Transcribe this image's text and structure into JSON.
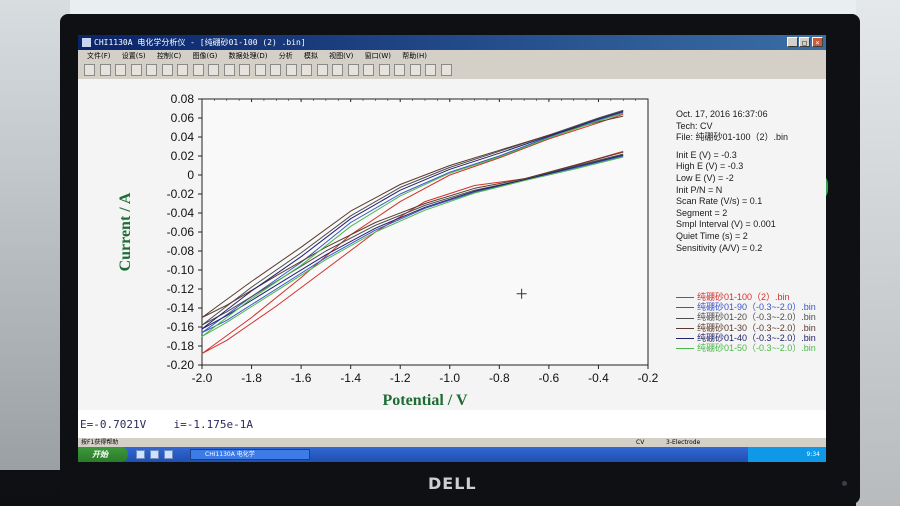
{
  "window": {
    "title": "CHI1130A 电化学分析仪 - [纯硼砂01-100 (2) .bin]",
    "controls": [
      "_",
      "□",
      "×"
    ]
  },
  "menu": [
    "文件(F)",
    "设置(S)",
    "控制(C)",
    "图像(G)",
    "数据处理(D)",
    "分析",
    "模拟",
    "视图(V)",
    "窗口(W)",
    "帮助(H)"
  ],
  "toolbar_icons": [
    "new-icon",
    "open-icon",
    "save-icon",
    "print-icon",
    "technique-icon",
    "parameters-icon",
    "run-icon",
    "pause-icon",
    "stop-icon",
    "reverse-icon",
    "ir-comp-icon",
    "filter-icon",
    "zoom-icon",
    "overlay-icon",
    "add-icon",
    "graph-icon",
    "color-icon",
    "smooth-icon",
    "derivative-icon",
    "integrate-icon",
    "baseline-icon",
    "peak-icon",
    "data-list-icon",
    "help-icon"
  ],
  "info": {
    "date": "Oct. 17, 2016   16:37:06",
    "tech": "Tech: CV",
    "file": "File: 纯硼砂01-100（2）.bin",
    "params": [
      "Init E (V) = -0.3",
      "High E (V) = -0.3",
      "Low E (V) = -2",
      "Init P/N = N",
      "Scan Rate (V/s) = 0.1",
      "Segment = 2",
      "Smpl Interval (V) = 0.001",
      "Quiet Time (s) = 2",
      "Sensitivity (A/V) = 0.2"
    ]
  },
  "legend": [
    {
      "label": "纯硼砂01-100（2）.bin",
      "color": "#d2312b"
    },
    {
      "label": "纯硼砂01-90（-0.3~-2.0）.bin",
      "color": "#3a55c8"
    },
    {
      "label": "纯硼砂01-20（-0.3~-2.0）.bin",
      "color": "#4d4d4d"
    },
    {
      "label": "纯硼砂01-30（-0.3~-2.0）.bin",
      "color": "#5a3a2e"
    },
    {
      "label": "纯硼砂01-40（-0.3~-2.0）.bin",
      "color": "#20206b"
    },
    {
      "label": "纯硼砂01-50（-0.3~-2.0）.bin",
      "color": "#4bb84b"
    }
  ],
  "readout": {
    "e": "E=-0.7021V",
    "i": "i=-1.175e-1A"
  },
  "status": {
    "left": "按F1获得帮助",
    "mid": "CV",
    "right": "3-Electrode"
  },
  "taskbar": {
    "start": "开始",
    "task": "CHI1130A 电化学",
    "clock": "9:34"
  },
  "brand": "DELL",
  "chart_data": {
    "type": "line",
    "title": "",
    "xlabel": "Potential / V",
    "ylabel": "Current / A",
    "xlim": [
      -2.0,
      -0.2
    ],
    "ylim": [
      -0.2,
      0.08
    ],
    "x_ticks": [
      -2.0,
      -1.8,
      -1.6,
      -1.4,
      -1.2,
      -1.0,
      -0.8,
      -0.6,
      -0.4,
      -0.2
    ],
    "y_ticks": [
      0.08,
      0.06,
      0.04,
      0.02,
      0,
      -0.02,
      -0.04,
      -0.06,
      -0.08,
      -0.1,
      -0.12,
      -0.14,
      -0.16,
      -0.18,
      -0.2
    ],
    "x_tick_labels": [
      "-2.0",
      "-1.8",
      "-1.6",
      "-1.4",
      "-1.2",
      "-1.0",
      "-0.8",
      "-0.6",
      "-0.4",
      "-0.2"
    ],
    "y_tick_labels": [
      "0.08",
      "0.06",
      "0.04",
      "0.02",
      "0",
      "-0.02",
      "-0.04",
      "-0.06",
      "-0.08",
      "-0.10",
      "-0.12",
      "-0.14",
      "-0.16",
      "-0.18",
      "-0.20"
    ],
    "grid": false,
    "legend_position": "right",
    "cursor_marker": {
      "x": -0.71,
      "y": -0.125
    },
    "series": [
      {
        "name": "纯硼砂01-100（2）.bin",
        "color": "#d2312b",
        "x": [
          -0.3,
          -0.5,
          -0.7,
          -0.9,
          -1.1,
          -1.3,
          -1.5,
          -1.7,
          -1.9,
          -2.0,
          -1.8,
          -1.6,
          -1.4,
          -1.2,
          -1.0,
          -0.8,
          -0.6,
          -0.4,
          -0.3
        ],
        "y": [
          0.025,
          0.01,
          -0.004,
          -0.011,
          -0.028,
          -0.06,
          -0.099,
          -0.138,
          -0.174,
          -0.188,
          -0.15,
          -0.108,
          -0.063,
          -0.028,
          0.0,
          0.018,
          0.038,
          0.055,
          0.064
        ]
      },
      {
        "name": "纯硼砂01-90（-0.3~-2.0）.bin",
        "color": "#3a55c8",
        "x": [
          -0.3,
          -0.5,
          -0.7,
          -0.9,
          -1.1,
          -1.3,
          -1.5,
          -1.7,
          -1.9,
          -2.0,
          -1.8,
          -1.6,
          -1.4,
          -1.2,
          -1.0,
          -0.8,
          -0.6,
          -0.4,
          -0.3
        ],
        "y": [
          0.02,
          0.007,
          -0.005,
          -0.018,
          -0.035,
          -0.058,
          -0.087,
          -0.12,
          -0.153,
          -0.166,
          -0.128,
          -0.092,
          -0.05,
          -0.02,
          0.003,
          0.02,
          0.04,
          0.058,
          0.066
        ]
      },
      {
        "name": "纯硼砂01-20（-0.3~-2.0）.bin",
        "color": "#4d4d4d",
        "x": [
          -0.3,
          -0.5,
          -0.7,
          -0.9,
          -1.1,
          -1.3,
          -1.5,
          -1.7,
          -1.9,
          -2.0,
          -1.8,
          -1.6,
          -1.4,
          -1.2,
          -1.0,
          -0.8,
          -0.6,
          -0.4,
          -0.3
        ],
        "y": [
          0.022,
          0.009,
          -0.005,
          -0.016,
          -0.032,
          -0.053,
          -0.08,
          -0.112,
          -0.144,
          -0.158,
          -0.118,
          -0.082,
          -0.043,
          -0.013,
          0.008,
          0.025,
          0.042,
          0.06,
          0.068
        ]
      },
      {
        "name": "纯硼砂01-30（-0.3~-2.0）.bin",
        "color": "#5a3a2e",
        "x": [
          -0.3,
          -0.5,
          -0.7,
          -0.9,
          -1.1,
          -1.3,
          -1.5,
          -1.7,
          -1.9,
          -2.0,
          -1.8,
          -1.6,
          -1.4,
          -1.2,
          -1.0,
          -0.8,
          -0.6,
          -0.4,
          -0.3
        ],
        "y": [
          0.024,
          0.01,
          -0.004,
          -0.014,
          -0.03,
          -0.05,
          -0.076,
          -0.106,
          -0.137,
          -0.15,
          -0.112,
          -0.076,
          -0.038,
          -0.01,
          0.01,
          0.026,
          0.042,
          0.056,
          0.062
        ]
      },
      {
        "name": "纯硼砂01-40（-0.3~-2.0）.bin",
        "color": "#20206b",
        "x": [
          -0.3,
          -0.5,
          -0.7,
          -0.9,
          -1.1,
          -1.3,
          -1.5,
          -1.7,
          -1.9,
          -2.0,
          -1.8,
          -1.6,
          -1.4,
          -1.2,
          -1.0,
          -0.8,
          -0.6,
          -0.4,
          -0.3
        ],
        "y": [
          0.021,
          0.008,
          -0.005,
          -0.017,
          -0.034,
          -0.056,
          -0.084,
          -0.116,
          -0.148,
          -0.162,
          -0.122,
          -0.086,
          -0.046,
          -0.016,
          0.006,
          0.023,
          0.041,
          0.059,
          0.067
        ]
      },
      {
        "name": "纯硼砂01-50（-0.3~-2.0）.bin",
        "color": "#4bb84b",
        "x": [
          -0.3,
          -0.5,
          -0.7,
          -0.9,
          -1.1,
          -1.3,
          -1.5,
          -1.7,
          -1.9,
          -2.0,
          -1.8,
          -1.6,
          -1.4,
          -1.2,
          -1.0,
          -0.8,
          -0.6,
          -0.4,
          -0.3
        ],
        "y": [
          0.019,
          0.006,
          -0.006,
          -0.019,
          -0.037,
          -0.06,
          -0.089,
          -0.122,
          -0.155,
          -0.17,
          -0.13,
          -0.095,
          -0.054,
          -0.022,
          0.002,
          0.019,
          0.039,
          0.057,
          0.065
        ]
      }
    ]
  }
}
